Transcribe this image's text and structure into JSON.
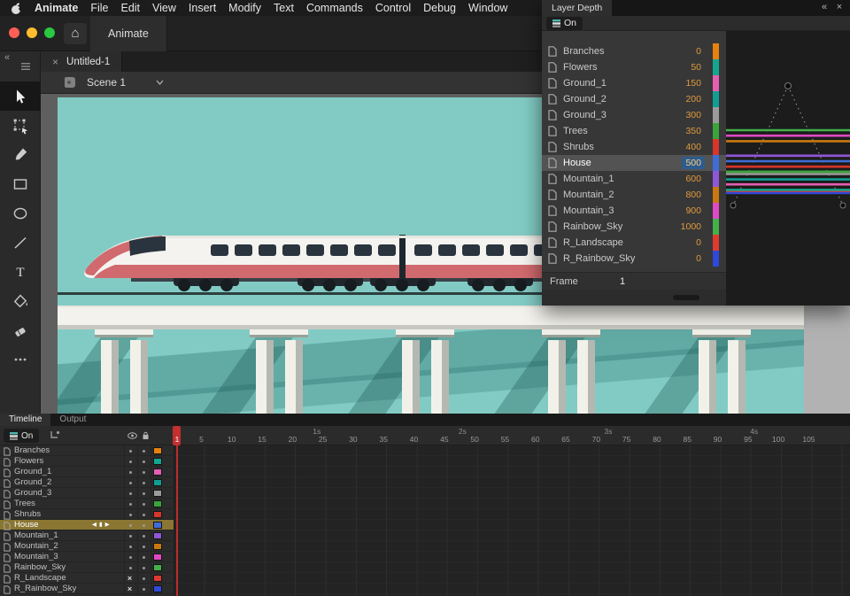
{
  "menubar": {
    "app_name": "Animate",
    "items": [
      "File",
      "Edit",
      "View",
      "Insert",
      "Modify",
      "Text",
      "Commands",
      "Control",
      "Debug",
      "Window"
    ]
  },
  "chrome": {
    "home_tab_label": "Animate"
  },
  "document": {
    "close_glyph": "×",
    "tab_title": "Untitled-1",
    "scene_label": "Scene 1"
  },
  "layer_depth_panel": {
    "title": "Layer Depth",
    "collapse_glyph": "«",
    "close_glyph": "×",
    "on_label": "On",
    "frame_label": "Frame",
    "frame_value": "1"
  },
  "layers": [
    {
      "name": "Branches",
      "depth": "0",
      "color": "#e8820e",
      "hidden": false,
      "selected": false
    },
    {
      "name": "Flowers",
      "depth": "50",
      "color": "#13a68f",
      "hidden": false,
      "selected": false
    },
    {
      "name": "Ground_1",
      "depth": "150",
      "color": "#e45fb1",
      "hidden": false,
      "selected": false
    },
    {
      "name": "Ground_2",
      "depth": "200",
      "color": "#0f9e94",
      "hidden": false,
      "selected": false
    },
    {
      "name": "Ground_3",
      "depth": "300",
      "color": "#9b9b9b",
      "hidden": false,
      "selected": false
    },
    {
      "name": "Trees",
      "depth": "350",
      "color": "#3aa53a",
      "hidden": false,
      "selected": false
    },
    {
      "name": "Shrubs",
      "depth": "400",
      "color": "#d8352b",
      "hidden": false,
      "selected": false
    },
    {
      "name": "House",
      "depth": "500",
      "color": "#3f6dd8",
      "hidden": false,
      "selected": true
    },
    {
      "name": "Mountain_1",
      "depth": "600",
      "color": "#8f56d8",
      "hidden": false,
      "selected": false
    },
    {
      "name": "Mountain_2",
      "depth": "800",
      "color": "#c8780f",
      "hidden": false,
      "selected": false
    },
    {
      "name": "Mountain_3",
      "depth": "900",
      "color": "#df49c3",
      "hidden": false,
      "selected": false
    },
    {
      "name": "Rainbow_Sky",
      "depth": "1000",
      "color": "#43b049",
      "hidden": false,
      "selected": false
    },
    {
      "name": "R_Landscape",
      "depth": "0",
      "color": "#e03a30",
      "hidden": true,
      "selected": false
    },
    {
      "name": "R_Rainbow_Sky",
      "depth": "0",
      "color": "#2f49d8",
      "hidden": true,
      "selected": false
    }
  ],
  "timeline": {
    "tabs": [
      "Timeline",
      "Output"
    ],
    "active_tab": "Timeline",
    "on_label": "On",
    "hidden_glyph": "×",
    "nav_glyphs": [
      "◀",
      "▮",
      "▶"
    ],
    "ruler_frames": [
      1,
      5,
      10,
      15,
      20,
      25,
      30,
      35,
      40,
      45,
      50,
      55,
      60,
      65,
      70,
      75,
      80,
      85,
      90,
      95,
      100,
      105
    ],
    "ruler_seconds": [
      {
        "label": "1s",
        "frame": 24
      },
      {
        "label": "2s",
        "frame": 48
      },
      {
        "label": "3s",
        "frame": 72
      },
      {
        "label": "4s",
        "frame": 96
      }
    ],
    "playhead_frame": 1
  },
  "stage": {
    "colors": {
      "sky": "#82cbc4",
      "deck": "#f3f2ec",
      "deck-edge": "#c7c9c1",
      "pier": "#f1f1ea",
      "pier-shade": "#b4b8b1",
      "train-red": "#d06a6e",
      "train-body": "#f5f3ef",
      "train-dark": "#2a343e",
      "track": "#2d3f3f"
    }
  }
}
